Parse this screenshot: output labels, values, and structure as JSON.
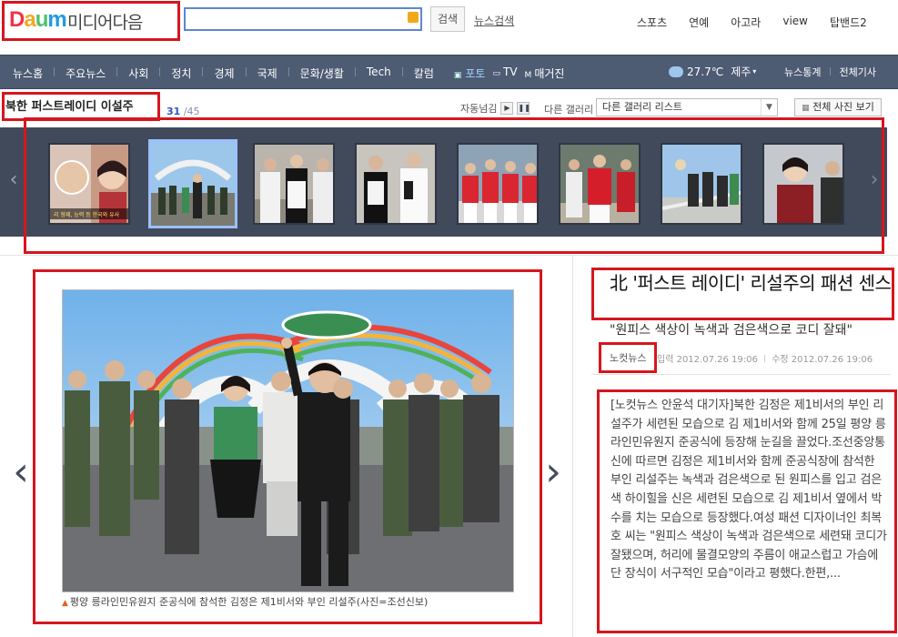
{
  "header": {
    "logo_daum": "Daum",
    "logo_media": "미디어다음",
    "search_button": "검색",
    "news_search": "뉴스검색",
    "top_links": [
      "스포츠",
      "연예",
      "아고라",
      "view",
      "탑밴드2"
    ]
  },
  "gnb": {
    "items": [
      "뉴스홈",
      "주요뉴스",
      "사회",
      "정치",
      "경제",
      "국제",
      "문화/생활",
      "Tech",
      "칼럼"
    ],
    "media": [
      "포토",
      "TV",
      "매거진"
    ],
    "weather": {
      "temp": "27.7℃",
      "city": "제주"
    },
    "right_links": [
      "뉴스통계",
      "전체기사"
    ]
  },
  "gallery": {
    "title": "북한 퍼스트레이디 이설주",
    "current": "31",
    "total": "/45",
    "autoplay_label": "자동넘김",
    "other_gallery_label": "다른 갤러리",
    "other_gallery_select": "다른 갤러리 리스트",
    "view_all": "전체 사진 보기",
    "thumbnail_overlay_text": "리 형제, 능력 등 한국와 유사",
    "selected_index": 1
  },
  "photo": {
    "caption": "평양 릉라인민유원지 준공식에 참석한 김정은 제1비서와 부인 리설주(사진=조선신보)"
  },
  "article": {
    "title": "北 '퍼스트 레이디' 리설주의 패션 센스",
    "subtitle": "\"원피스 색상이 녹색과 검은색으로 코디 잘돼\"",
    "source": "노컷뉴스",
    "published": "입력 2012.07.26 19:06",
    "modified": "수정 2012.07.26 19:06",
    "body": "[노컷뉴스 안윤석 대기자]북한 김정은 제1비서의 부인 리설주가 세련된 모습으로 김 제1비서와 함께 25일 평양 릉라인민유원지 준공식에 등장해 눈길을 끌었다.조선중앙통신에 따르면 김정은 제1비서와 함께 준공식장에 참석한 부인 리설주는 녹색과 검은색으로 된 원피스를 입고 검은색 하이힐을 신은 세련된 모습으로 김 제1비서 옆에서 박수를 치는 모습으로 등장했다.여성 패션 디자이너인 최복호 씨는 \"원피스 색상이 녹색과 검은색으로 세련돼 코디가 잘됐으며, 허리에 물결모양의 주름이 애교스럽고 가슴에 단 장식이 서구적인 모습\"이라고 평했다.한편,..."
  },
  "colors": {
    "highlight_box": "#d6161e",
    "gnb": "#4d5b73",
    "filmstrip": "#414a5b",
    "logo_d": "#f0324b",
    "logo_a": "#f5a623",
    "logo_u": "#4ec36b",
    "logo_m": "#1f9ce0"
  }
}
